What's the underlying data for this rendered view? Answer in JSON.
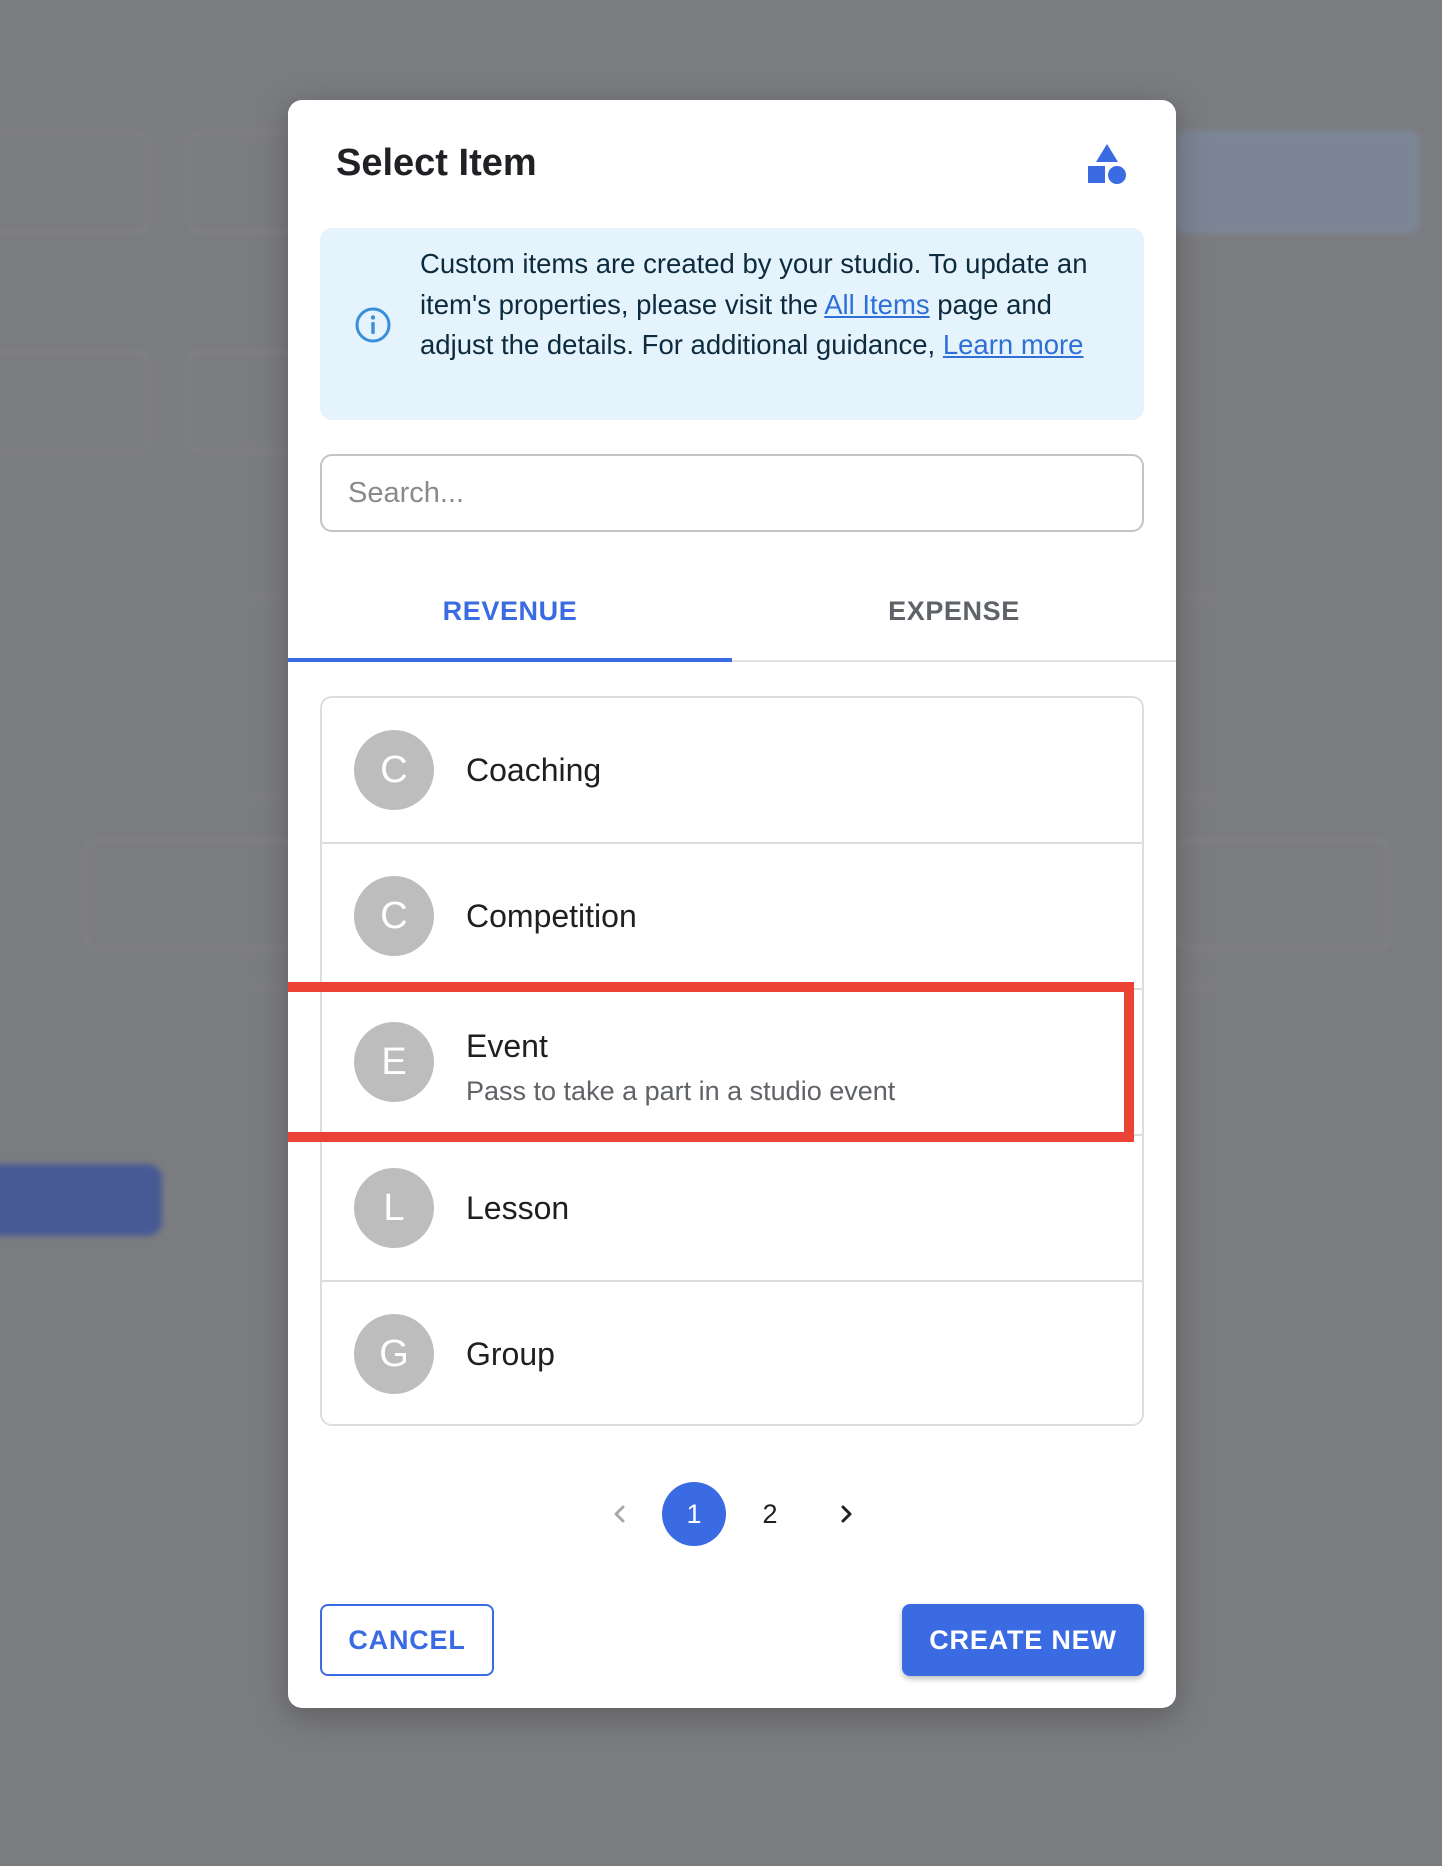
{
  "colors": {
    "accent": "#3a6be3",
    "highlight": "#ea4335",
    "info_background": "#e5f4fc",
    "avatar": "#bdbdbd",
    "backdrop": "#7b7c7f"
  },
  "dialog": {
    "title": "Select Item",
    "header_icon": "shapes-icon",
    "info": {
      "icon": "info-icon",
      "text_1": "Custom items are created by your studio. To update an item's properties, please visit the ",
      "link_all_items": "All Items",
      "text_2": " page and adjust the details. For additional guidance, ",
      "link_learn_more": "Learn more"
    },
    "search": {
      "placeholder": "Search...",
      "value": ""
    },
    "tabs": [
      {
        "label": "REVENUE",
        "selected": true
      },
      {
        "label": "EXPENSE",
        "selected": false
      }
    ],
    "items": [
      {
        "initial": "C",
        "title": "Coaching"
      },
      {
        "initial": "C",
        "title": "Competition"
      },
      {
        "initial": "E",
        "title": "Event",
        "subtitle": "Pass to take a part in a studio event",
        "highlighted": true
      },
      {
        "initial": "L",
        "title": "Lesson"
      },
      {
        "initial": "G",
        "title": "Group"
      }
    ],
    "pagination": {
      "prev_icon": "chevron-left-icon",
      "pages": [
        "1",
        "2"
      ],
      "current_page": "1",
      "next_icon": "chevron-right-icon"
    },
    "actions": {
      "cancel_label": "CANCEL",
      "create_label": "CREATE NEW"
    }
  }
}
